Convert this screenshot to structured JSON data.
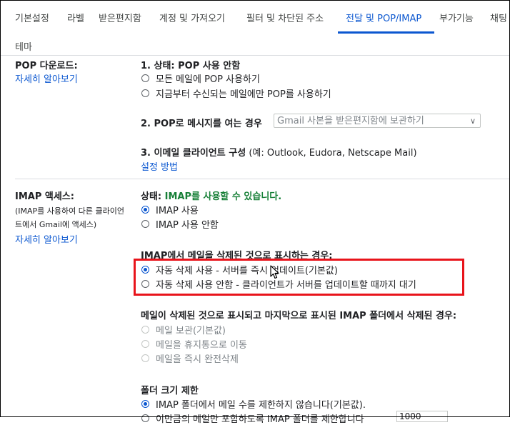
{
  "tabs": [
    "기본설정",
    "라벨",
    "받은편지함",
    "계정 및 가져오기",
    "필터 및 차단된 주소",
    "전달 및 POP/IMAP",
    "부가기능",
    "채팅"
  ],
  "tab_row2": "테마",
  "accent_color": "#0b57d0",
  "pop": {
    "title": "POP 다운로드:",
    "learn_more": "자세히 알아보기",
    "status_prefix": "1. 상태: ",
    "status_value": "POP 사용 안함",
    "opt_all": "모든 메일에 POP 사용하기",
    "opt_now": "지금부터 수신되는 메일에만 POP를 사용하기",
    "step2": "2. POP로 메시지를 여는 경우",
    "step2_select": "Gmail 사본을 받은편지함에 보관하기",
    "step3": "3. 이메일 클라이언트 구성",
    "step3_example": "(예: Outlook, Eudora, Netscape Mail)",
    "setup_link": "설정 방법"
  },
  "imap": {
    "title": "IMAP 액세스:",
    "desc_line1": "(IMAP를 사용하여 다른 클라이언",
    "desc_line2": "트에서 Gmail에 액세스)",
    "learn_more": "자세히 알아보기",
    "status_prefix": "상태: ",
    "status_value": "IMAP를 사용할 수 있습니다.",
    "opt_on": "IMAP 사용",
    "opt_off": "IMAP 사용 안함",
    "delete_heading": "IMAP에서 메일을 삭제된 것으로 표시하는 경우:",
    "auto_on": "자동 삭제 사용 - 서버를 즉시 업데이트(기본값)",
    "auto_off": "자동 삭제 사용 안함 - 클라이언트가 서버를 업데이트할 때까지 대기",
    "expunge_heading": "메일이 삭제된 것으로 표시되고 마지막으로 표시된 IMAP 폴더에서 삭제된 경우:",
    "exp_archive": "메일 보관(기본값)",
    "exp_trash": "메일을 휴지통으로 이동",
    "exp_delete": "메일을 즉시 완전삭제",
    "folder_heading": "폴더 크기 제한",
    "folder_opt1": "IMAP 폴더에서 메일 수를 제한하지 않습니다(기본값).",
    "folder_opt2": "이만큼의 메일만 포함하도록 IMAP 폴더를 제한합니다",
    "folder_limit_value": "1000"
  }
}
